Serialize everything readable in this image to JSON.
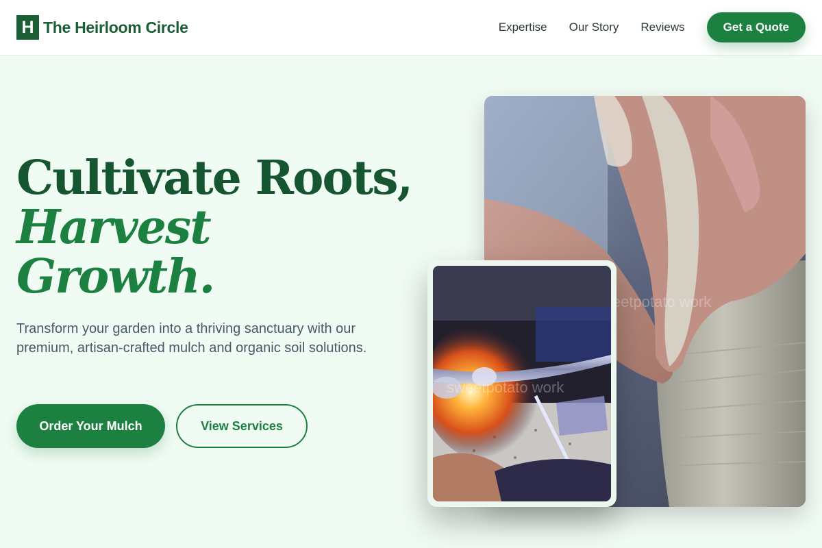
{
  "brand": {
    "mark": "H",
    "name": "The Heirloom Circle"
  },
  "nav": {
    "links": [
      "Expertise",
      "Our Story",
      "Reviews"
    ],
    "cta": "Get a Quote"
  },
  "hero": {
    "title_line1": "Cultivate Roots,",
    "title_line2": "Harvest",
    "title_line3": "Growth.",
    "subtitle": "Transform your garden into a thriving sanctuary with our premium, artisan-crafted mulch and organic soil solutions.",
    "primary_button": "Order Your Mulch",
    "secondary_button": "View Services"
  },
  "images": {
    "main": {
      "subject": "hands-shaping-clay-pot-photo",
      "watermark": "sweetpotato work"
    },
    "inset": {
      "subject": "glassblowing-flame-photo",
      "watermark": "sweetpotato work"
    }
  },
  "colors": {
    "brand_dark": "#1b5e36",
    "brand": "#1c8040",
    "background": "#f0fbf3",
    "body_text": "#465a67"
  }
}
